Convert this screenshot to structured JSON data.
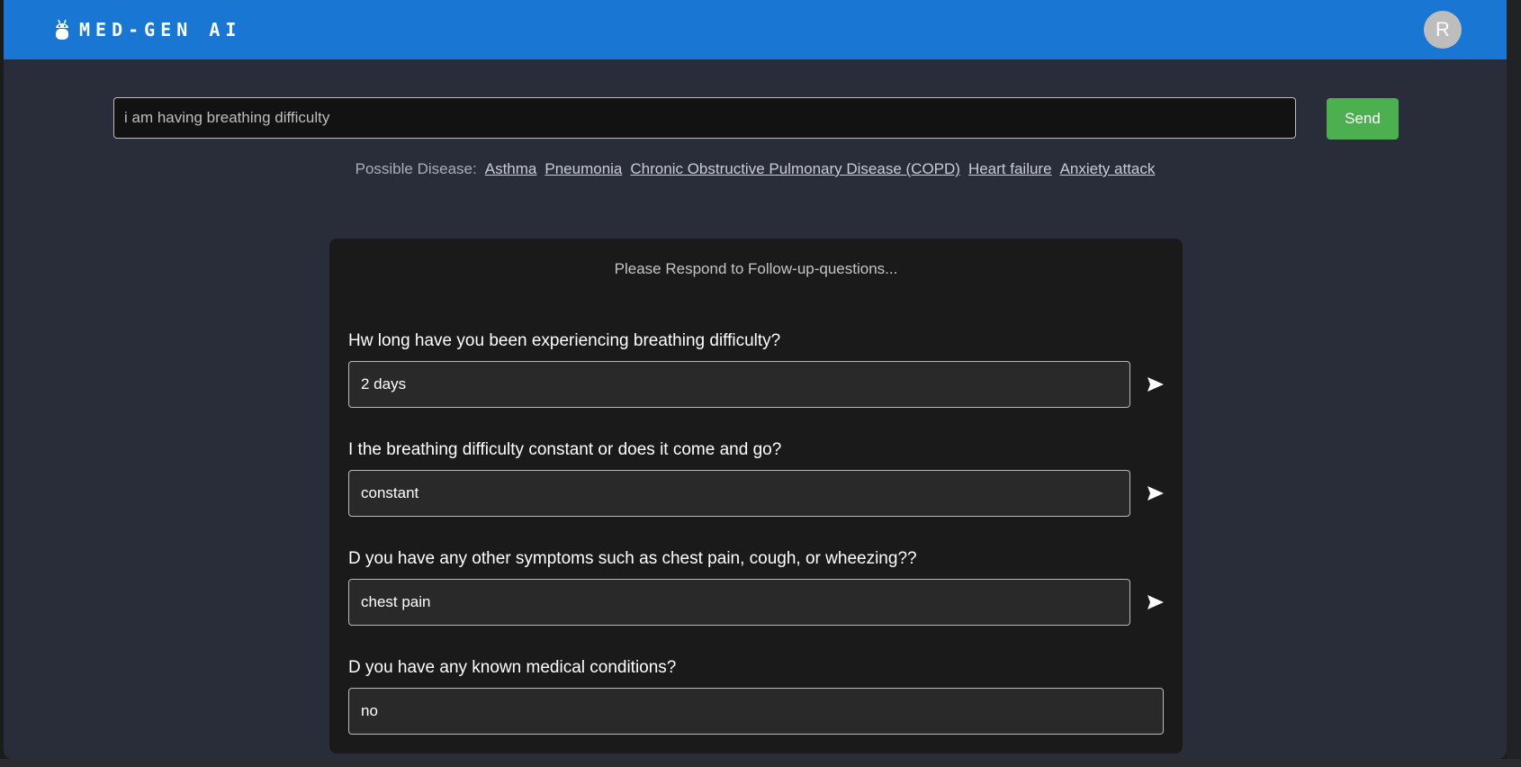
{
  "header": {
    "brand": "MED-GEN AI",
    "logo_icon": "robot-icon",
    "avatar_initial": "R",
    "color": "#1976d2"
  },
  "search": {
    "value": "i am having breathing difficulty",
    "send_label": "Send"
  },
  "diseases": {
    "label": "Possible Disease:",
    "items": [
      "Asthma",
      "Pneumonia",
      "Chronic Obstructive Pulmonary Disease (COPD)",
      "Heart failure",
      "Anxiety attack"
    ]
  },
  "followup": {
    "heading": "Please Respond to Follow-up-questions...",
    "send_icon": "send-arrow-icon",
    "questions": [
      {
        "question": "Hw long have you been experiencing breathing difficulty?",
        "answer": "2 days"
      },
      {
        "question": "I the breathing difficulty constant or does it come and go?",
        "answer": "constant"
      },
      {
        "question": "D you have any other symptoms such as chest pain, cough, or wheezing??",
        "answer": "chest pain"
      },
      {
        "question": "D you have any known medical conditions?",
        "answer": "no"
      }
    ]
  },
  "colors": {
    "background": "#282d39",
    "panel": "#1a1a1a",
    "send_button": "#4caf50"
  }
}
